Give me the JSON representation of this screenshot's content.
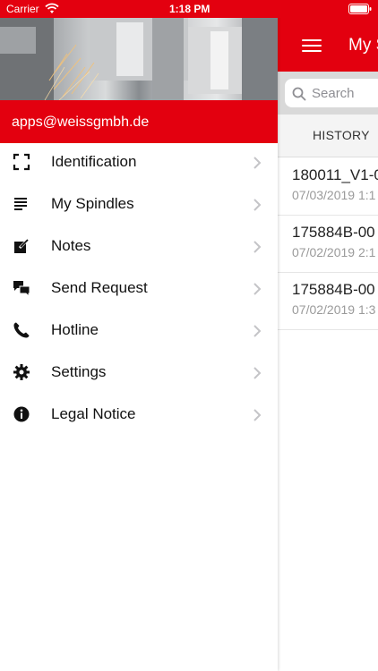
{
  "status_bar": {
    "carrier": "Carrier",
    "time": "1:18 PM"
  },
  "main": {
    "title": "My S",
    "search": {
      "placeholder": "Search"
    },
    "tabs": [
      {
        "label": "HISTORY"
      }
    ],
    "history": [
      {
        "title": "180011_V1-0",
        "date": "07/03/2019 1:1"
      },
      {
        "title": "175884B-00",
        "date": "07/02/2019 2:1"
      },
      {
        "title": "175884B-00",
        "date": "07/02/2019 1:3"
      }
    ]
  },
  "drawer": {
    "account_email": "apps@weissgmbh.de",
    "items": [
      {
        "label": "Identification",
        "icon": "scan-frame-icon"
      },
      {
        "label": "My Spindles",
        "icon": "list-icon"
      },
      {
        "label": "Notes",
        "icon": "edit-note-icon"
      },
      {
        "label": "Send Request",
        "icon": "chat-bubbles-icon"
      },
      {
        "label": "Hotline",
        "icon": "phone-icon"
      },
      {
        "label": "Settings",
        "icon": "gear-icon"
      },
      {
        "label": "Legal Notice",
        "icon": "info-icon"
      }
    ]
  },
  "colors": {
    "brand_red": "#e3000f"
  }
}
